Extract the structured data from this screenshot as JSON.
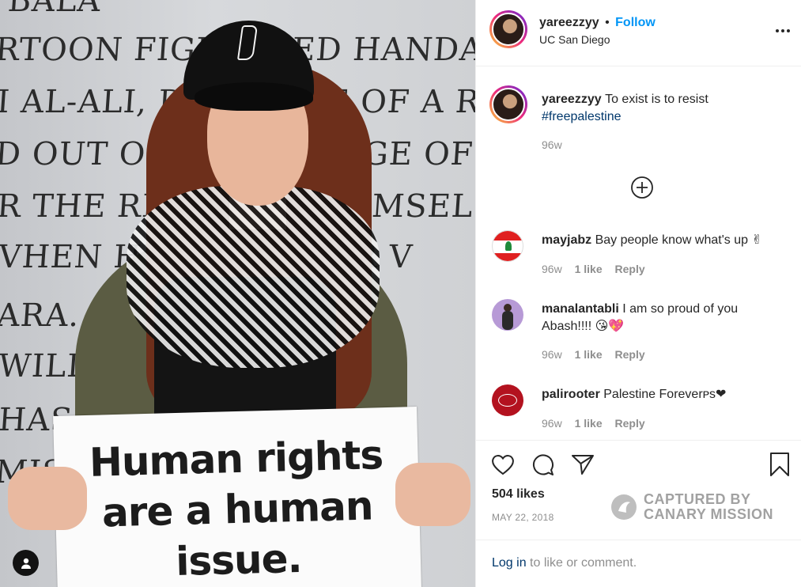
{
  "photo": {
    "wall_lines": [
      "BALA",
      "RTOON FIGUR   MED HANDAL",
      "I AL-ALI, DEPICT   RE OF A REFU",
      "D OUT OF HIS   THE AGE OF",
      "R THE RIGHT T   ST HIMSEL",
      "VHEN HIS F   M THEIR V",
      "ARA. ACCOR   O REMAI",
      "WILL NC   O HIS",
      "HAS B   ISM A",
      "MIS"
    ],
    "sign_text": [
      "Human rights",
      "are a human",
      "issue."
    ]
  },
  "header": {
    "username": "yareezzyy",
    "separator": "•",
    "follow_label": "Follow",
    "location": "UC San Diego",
    "more_icon": "more-horizontal-icon"
  },
  "caption": {
    "username": "yareezzyy",
    "text": "To exist is to resist",
    "hashtag": "#freepalestine",
    "time": "96w"
  },
  "load_more_icon": "plus-circle-icon",
  "comments": [
    {
      "username": "mayjabz",
      "text": "Bay people know what's up ✌",
      "time": "96w",
      "likes": "1 like",
      "reply": "Reply"
    },
    {
      "username": "manalantabli",
      "text": "I am so proud of you Abash!!!! 😘💖",
      "time": "96w",
      "likes": "1 like",
      "reply": "Reply"
    },
    {
      "username": "palirooter",
      "text": "Palestine Foreverᴘs❤",
      "time": "96w",
      "likes": "1 like",
      "reply": "Reply"
    }
  ],
  "actions": {
    "likes": "504 likes",
    "date": "MAY 22, 2018",
    "icons": [
      "heart-icon",
      "comment-icon",
      "share-icon",
      "bookmark-icon"
    ]
  },
  "watermark": {
    "line1": "CAPTURED BY",
    "line2": "CANARY MISSION"
  },
  "footer": {
    "login_label": "Log in",
    "suffix": " to like or comment."
  },
  "colors": {
    "accent": "#0095f6",
    "link": "#00376b",
    "muted": "#8e8e8e",
    "text": "#262626",
    "heart": "#ed4956"
  }
}
